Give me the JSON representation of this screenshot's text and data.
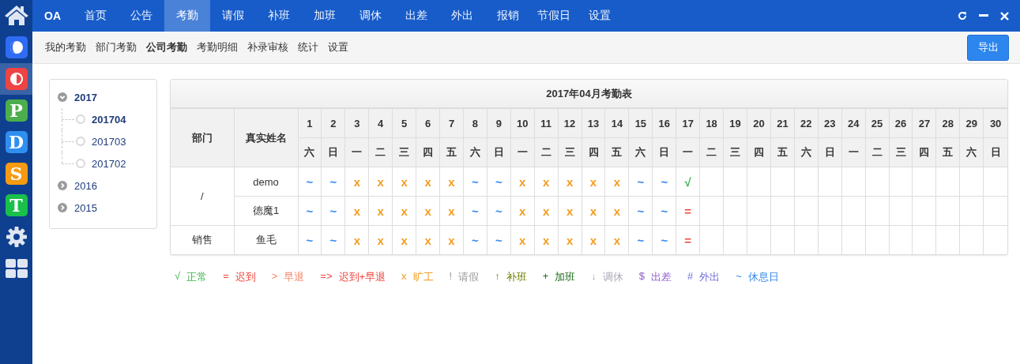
{
  "sidebar": {
    "apps": [
      {
        "kind": "moon",
        "color": "#2f6cf4",
        "selected": false
      },
      {
        "kind": "half",
        "color": "#ee4444",
        "selected": true
      },
      {
        "kind": "letter",
        "letter": "P",
        "color": "#4cae4c",
        "selected": false
      },
      {
        "kind": "letter",
        "letter": "D",
        "color": "#2f8ff0",
        "selected": false
      },
      {
        "kind": "letter",
        "letter": "S",
        "color": "#f59a12",
        "selected": false
      },
      {
        "kind": "letter",
        "letter": "T",
        "color": "#19c04a",
        "selected": false
      },
      {
        "kind": "gear",
        "selected": false
      },
      {
        "kind": "grid",
        "selected": false
      }
    ]
  },
  "top_nav": {
    "brand": "OA",
    "tabs": [
      {
        "label": "首页",
        "selected": false
      },
      {
        "label": "公告",
        "selected": false
      },
      {
        "label": "考勤",
        "selected": true
      },
      {
        "label": "请假",
        "selected": false
      },
      {
        "label": "补班",
        "selected": false
      },
      {
        "label": "加班",
        "selected": false
      },
      {
        "label": "调休",
        "selected": false
      },
      {
        "label": "出差",
        "selected": false
      },
      {
        "label": "外出",
        "selected": false
      },
      {
        "label": "报销",
        "selected": false
      },
      {
        "label": "节假日",
        "selected": false
      },
      {
        "label": "设置",
        "selected": false
      }
    ]
  },
  "sub_nav": {
    "items": [
      {
        "label": "我的考勤",
        "selected": false
      },
      {
        "label": "部门考勤",
        "selected": false
      },
      {
        "label": "公司考勤",
        "selected": true
      },
      {
        "label": "考勤明细",
        "selected": false
      },
      {
        "label": "补录审核",
        "selected": false
      },
      {
        "label": "统计",
        "selected": false
      },
      {
        "label": "设置",
        "selected": false
      }
    ],
    "export_button": "导出"
  },
  "tree": [
    {
      "label": "2017",
      "expanded": true,
      "selected": false,
      "children": [
        {
          "label": "201704",
          "selected": true
        },
        {
          "label": "201703",
          "selected": false
        },
        {
          "label": "201702",
          "selected": false
        }
      ]
    },
    {
      "label": "2016",
      "expanded": false,
      "selected": false
    },
    {
      "label": "2015",
      "expanded": false,
      "selected": false
    }
  ],
  "table": {
    "title": "2017年04月考勤表",
    "columns": [
      "部门",
      "真实姓名"
    ],
    "days": [
      {
        "day": "1",
        "weekday": "六"
      },
      {
        "day": "2",
        "weekday": "日"
      },
      {
        "day": "3",
        "weekday": "一"
      },
      {
        "day": "4",
        "weekday": "二"
      },
      {
        "day": "5",
        "weekday": "三"
      },
      {
        "day": "6",
        "weekday": "四"
      },
      {
        "day": "7",
        "weekday": "五"
      },
      {
        "day": "8",
        "weekday": "六"
      },
      {
        "day": "9",
        "weekday": "日"
      },
      {
        "day": "10",
        "weekday": "一"
      },
      {
        "day": "11",
        "weekday": "二"
      },
      {
        "day": "12",
        "weekday": "三"
      },
      {
        "day": "13",
        "weekday": "四"
      },
      {
        "day": "14",
        "weekday": "五"
      },
      {
        "day": "15",
        "weekday": "六"
      },
      {
        "day": "16",
        "weekday": "日"
      },
      {
        "day": "17",
        "weekday": "一"
      },
      {
        "day": "18",
        "weekday": "二"
      },
      {
        "day": "19",
        "weekday": "三"
      },
      {
        "day": "20",
        "weekday": "四"
      },
      {
        "day": "21",
        "weekday": "五"
      },
      {
        "day": "22",
        "weekday": "六"
      },
      {
        "day": "23",
        "weekday": "日"
      },
      {
        "day": "24",
        "weekday": "一"
      },
      {
        "day": "25",
        "weekday": "二"
      },
      {
        "day": "26",
        "weekday": "三"
      },
      {
        "day": "27",
        "weekday": "四"
      },
      {
        "day": "28",
        "weekday": "五"
      },
      {
        "day": "29",
        "weekday": "六"
      },
      {
        "day": "30",
        "weekday": "日"
      }
    ],
    "groups": [
      {
        "department": "/",
        "members": [
          {
            "name": "demo",
            "cells": [
              {
                "mark": "~",
                "kind": "rest"
              },
              {
                "mark": "~",
                "kind": "rest"
              },
              {
                "mark": "x",
                "kind": "absent"
              },
              {
                "mark": "x",
                "kind": "absent"
              },
              {
                "mark": "x",
                "kind": "absent"
              },
              {
                "mark": "x",
                "kind": "absent"
              },
              {
                "mark": "x",
                "kind": "absent"
              },
              {
                "mark": "~",
                "kind": "rest"
              },
              {
                "mark": "~",
                "kind": "rest"
              },
              {
                "mark": "x",
                "kind": "absent"
              },
              {
                "mark": "x",
                "kind": "absent"
              },
              {
                "mark": "x",
                "kind": "absent"
              },
              {
                "mark": "x",
                "kind": "absent"
              },
              {
                "mark": "x",
                "kind": "absent"
              },
              {
                "mark": "~",
                "kind": "rest"
              },
              {
                "mark": "~",
                "kind": "rest"
              },
              {
                "mark": "√",
                "kind": "normal"
              }
            ]
          },
          {
            "name": "德魔1",
            "cells": [
              {
                "mark": "~",
                "kind": "rest"
              },
              {
                "mark": "~",
                "kind": "rest"
              },
              {
                "mark": "x",
                "kind": "absent"
              },
              {
                "mark": "x",
                "kind": "absent"
              },
              {
                "mark": "x",
                "kind": "absent"
              },
              {
                "mark": "x",
                "kind": "absent"
              },
              {
                "mark": "x",
                "kind": "absent"
              },
              {
                "mark": "~",
                "kind": "rest"
              },
              {
                "mark": "~",
                "kind": "rest"
              },
              {
                "mark": "x",
                "kind": "absent"
              },
              {
                "mark": "x",
                "kind": "absent"
              },
              {
                "mark": "x",
                "kind": "absent"
              },
              {
                "mark": "x",
                "kind": "absent"
              },
              {
                "mark": "x",
                "kind": "absent"
              },
              {
                "mark": "~",
                "kind": "rest"
              },
              {
                "mark": "~",
                "kind": "rest"
              },
              {
                "mark": "=",
                "kind": "late"
              }
            ]
          }
        ]
      },
      {
        "department": "销售",
        "members": [
          {
            "name": "鱼毛",
            "cells": [
              {
                "mark": "~",
                "kind": "rest"
              },
              {
                "mark": "~",
                "kind": "rest"
              },
              {
                "mark": "x",
                "kind": "absent"
              },
              {
                "mark": "x",
                "kind": "absent"
              },
              {
                "mark": "x",
                "kind": "absent"
              },
              {
                "mark": "x",
                "kind": "absent"
              },
              {
                "mark": "x",
                "kind": "absent"
              },
              {
                "mark": "~",
                "kind": "rest"
              },
              {
                "mark": "~",
                "kind": "rest"
              },
              {
                "mark": "x",
                "kind": "absent"
              },
              {
                "mark": "x",
                "kind": "absent"
              },
              {
                "mark": "x",
                "kind": "absent"
              },
              {
                "mark": "x",
                "kind": "absent"
              },
              {
                "mark": "x",
                "kind": "absent"
              },
              {
                "mark": "~",
                "kind": "rest"
              },
              {
                "mark": "~",
                "kind": "rest"
              },
              {
                "mark": "=",
                "kind": "late"
              }
            ]
          }
        ]
      }
    ]
  },
  "legend": [
    {
      "symbol": "√",
      "label": "正常",
      "kind": "normal"
    },
    {
      "symbol": "=",
      "label": "迟到",
      "kind": "late"
    },
    {
      "symbol": ">",
      "label": "早退",
      "kind": "early"
    },
    {
      "symbol": "=>",
      "label": "迟到+早退",
      "kind": "late_early"
    },
    {
      "symbol": "x",
      "label": "旷工",
      "kind": "absent"
    },
    {
      "symbol": "!",
      "label": "请假",
      "kind": "leave"
    },
    {
      "symbol": "↑",
      "label": "补班",
      "kind": "makeup"
    },
    {
      "symbol": "+",
      "label": "加班",
      "kind": "overtime"
    },
    {
      "symbol": "↓",
      "label": "调休",
      "kind": "off"
    },
    {
      "symbol": "$",
      "label": "出差",
      "kind": "trip"
    },
    {
      "symbol": "#",
      "label": "外出",
      "kind": "out"
    },
    {
      "symbol": "~",
      "label": "休息日",
      "kind": "rest"
    }
  ]
}
